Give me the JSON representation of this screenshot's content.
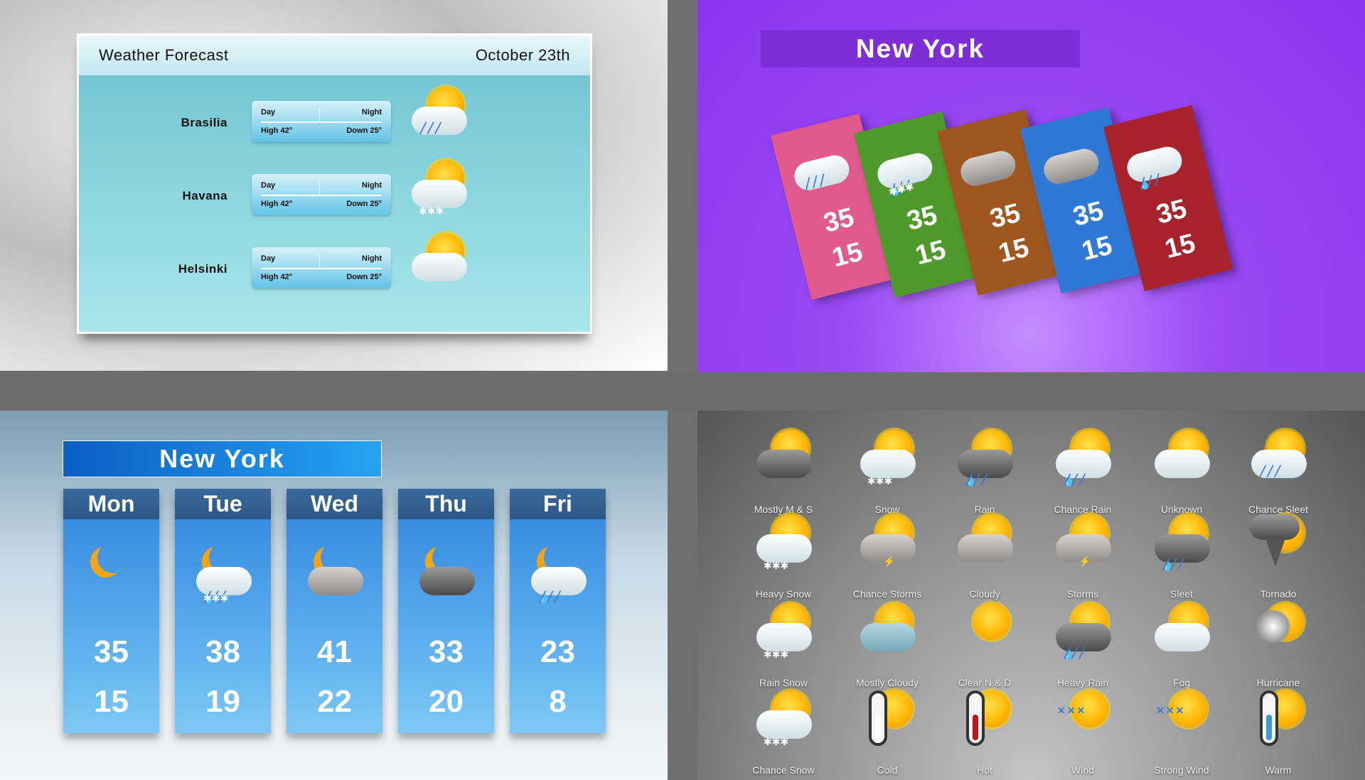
{
  "panel1": {
    "title": "Weather Forecast",
    "date": "October 23th",
    "rows": [
      {
        "city": "Brasilia",
        "day": "Day",
        "night": "Night",
        "high": "High 42°",
        "down": "Down 25°",
        "icon": "sun-sleet-icon"
      },
      {
        "city": "Havana",
        "day": "Day",
        "night": "Night",
        "high": "High 42°",
        "down": "Down 25°",
        "icon": "sun-snow-cloud-icon"
      },
      {
        "city": "Helsinki",
        "day": "Day",
        "night": "Night",
        "high": "High 42°",
        "down": "Down 25°",
        "icon": "sun-cloud-icon"
      }
    ]
  },
  "panel2": {
    "title": "New York",
    "cards": [
      {
        "high": "35",
        "low": "15",
        "color": "#e05a8f",
        "icon": "sleet-icon"
      },
      {
        "high": "35",
        "low": "15",
        "color": "#4f9a2a",
        "icon": "rain-snow-icon"
      },
      {
        "high": "35",
        "low": "15",
        "color": "#a0561f",
        "icon": "cloudy-icon"
      },
      {
        "high": "35",
        "low": "15",
        "color": "#2f78d4",
        "icon": "cloud-icon"
      },
      {
        "high": "35",
        "low": "15",
        "color": "#a8232b",
        "icon": "rain-icon"
      }
    ]
  },
  "panel3": {
    "title": "New York",
    "days": [
      {
        "name": "Mon",
        "high": "35",
        "low": "15",
        "icon": "moon-sleet-icon"
      },
      {
        "name": "Tue",
        "high": "38",
        "low": "19",
        "icon": "moon-rain-snow-icon"
      },
      {
        "name": "Wed",
        "high": "41",
        "low": "22",
        "icon": "moon-cloudy-icon"
      },
      {
        "name": "Thu",
        "high": "33",
        "low": "20",
        "icon": "night-cloudy-icon"
      },
      {
        "name": "Fri",
        "high": "23",
        "low": "8",
        "icon": "moon-rain-icon"
      }
    ]
  },
  "panel4": {
    "icons": [
      {
        "label": "Mostly M & S",
        "icon": "sun-dark-cloud"
      },
      {
        "label": "Snow",
        "icon": "sun-snow"
      },
      {
        "label": "Rain",
        "icon": "sun-rain-dark"
      },
      {
        "label": "Chance Rain",
        "icon": "sun-rain"
      },
      {
        "label": "Unknown",
        "icon": "sun-cloud"
      },
      {
        "label": "Chance Sleet",
        "icon": "sun-sleet"
      },
      {
        "label": "Heavy Snow",
        "icon": "sun-snow"
      },
      {
        "label": "Chance Storms",
        "icon": "sun-storm"
      },
      {
        "label": "Cloudy",
        "icon": "sun-grey-cloud"
      },
      {
        "label": "Storms",
        "icon": "sun-storm"
      },
      {
        "label": "Sleet",
        "icon": "sun-rain-dark"
      },
      {
        "label": "Tornado",
        "icon": "tornado"
      },
      {
        "label": "Rain Snow",
        "icon": "sun-snow"
      },
      {
        "label": "Mostly Cloudy",
        "icon": "sun-blue-cloud"
      },
      {
        "label": "Clear N & D",
        "icon": "sun"
      },
      {
        "label": "Heavy Rain",
        "icon": "sun-rain-dark"
      },
      {
        "label": "Fog",
        "icon": "sun-cloud"
      },
      {
        "label": "Hurricane",
        "icon": "hurricane"
      },
      {
        "label": "Chance Snow",
        "icon": "sun-snow"
      },
      {
        "label": "Cold",
        "icon": "thermometer-cold"
      },
      {
        "label": "Hot",
        "icon": "thermometer-hot"
      },
      {
        "label": "Wind",
        "icon": "wind"
      },
      {
        "label": "Strong Wind",
        "icon": "wind"
      },
      {
        "label": "Warm",
        "icon": "thermometer-warm"
      }
    ]
  }
}
